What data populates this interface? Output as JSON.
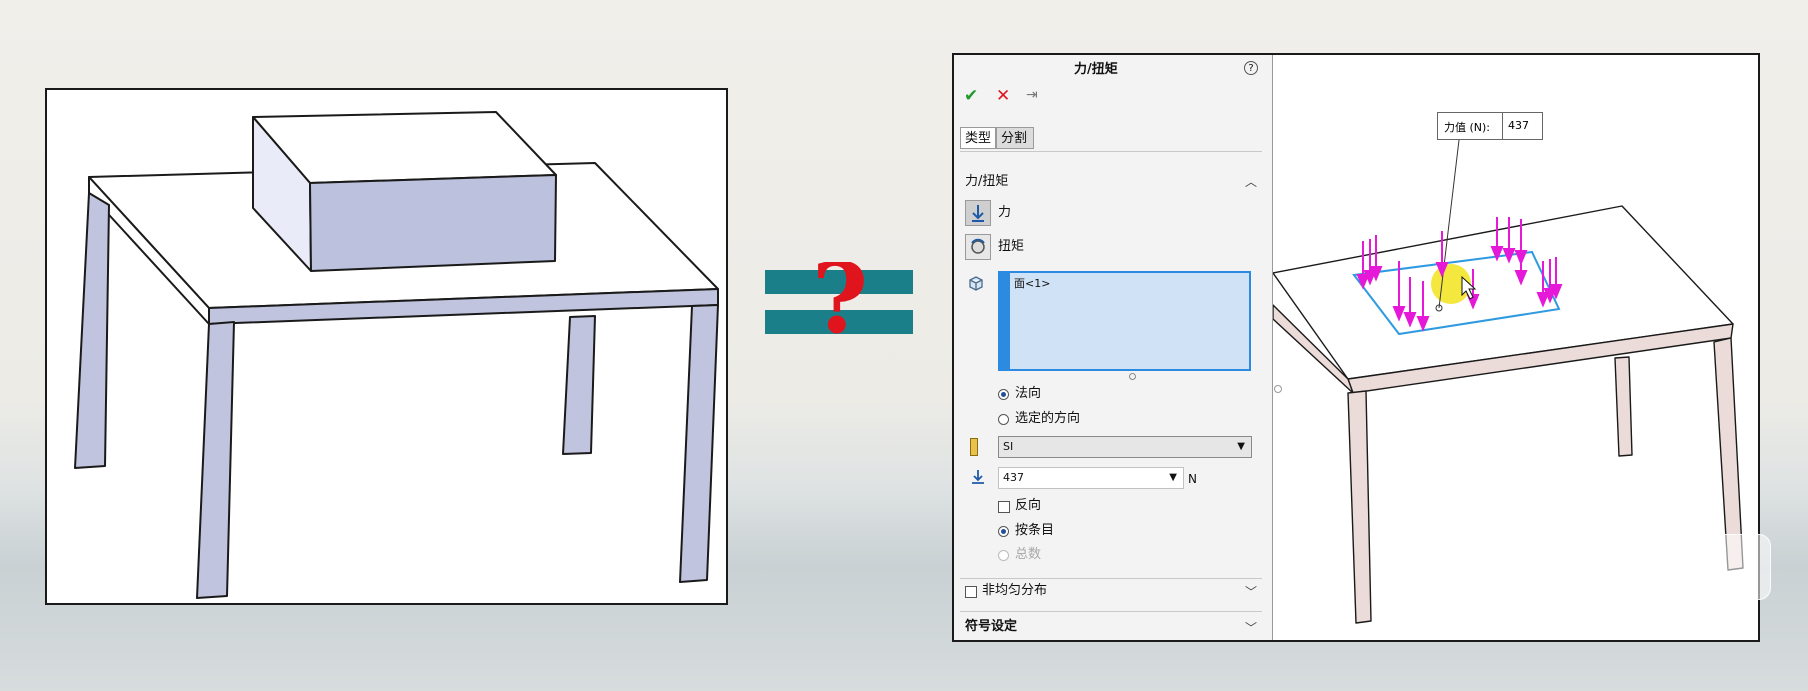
{
  "prop": {
    "title": "力/扭矩",
    "tabs": [
      "类型",
      "分割"
    ],
    "section_title": "力/扭矩",
    "force_label": "力",
    "torque_label": "扭矩",
    "selection_item": "面<1>",
    "direction_normal": "法向",
    "direction_selected": "选定的方向",
    "units_value": "SI",
    "force_value": "437",
    "force_unit": "N",
    "reverse_label": "反向",
    "per_item_label": "按条目",
    "total_label": "总数",
    "nonuniform_label": "非均匀分布",
    "symbol_settings_label": "符号设定"
  },
  "viewport": {
    "tip_label": "力值 (N):",
    "tip_value": "437"
  },
  "colors": {
    "table_edge": "#1a1a1a",
    "left_leg_fill": "#c0c4de",
    "box_front": "#bcc1dd",
    "box_side": "#e9ecf8",
    "equal_bars": "#1b7f8a",
    "question_mark": "#e0141c",
    "arrow_magenta": "#e619d8",
    "selection_blue": "#2f9ae0",
    "right_leg_fill": "#ecdcd9",
    "highlight_yellow": "#f2e31b"
  }
}
